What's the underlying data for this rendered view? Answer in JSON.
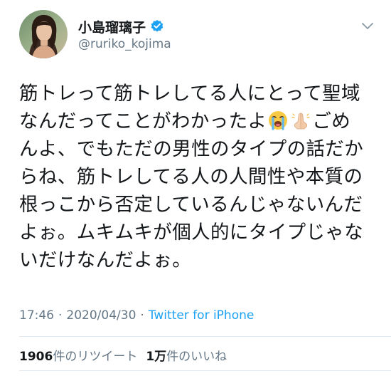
{
  "user": {
    "display_name": "小島瑠璃子",
    "handle": "@ruriko_kojima",
    "verified": true,
    "avatar_icon": "user-avatar-photo"
  },
  "tweet": {
    "lines": [
      "筋トレって筋トレしてる人にとって聖域",
      "なんだってことがわかったよ",
      "ごめ",
      "んよ、でもただの男性のタイプの話だか",
      "らね、筋トレしてる人の人間性や本質の",
      "根っこから否定しているんじゃないんだ",
      "よぉ。ムキムキが個人的にタイプじゃな",
      "いだけなんだよぉ。"
    ],
    "emojis": [
      "loudly-crying-face-emoji",
      "folded-hands-emoji"
    ]
  },
  "meta": {
    "time": "17:46",
    "separator": "·",
    "date": "2020/04/30",
    "source": "Twitter for iPhone"
  },
  "stats": {
    "retweets_count": "1906",
    "retweets_label": "件のリツイート",
    "likes_count": "1万",
    "likes_label": "件のいいね"
  },
  "colors": {
    "text_primary": "#14171a",
    "text_secondary": "#657786",
    "link": "#1da1f2",
    "verified": "#1da1f2",
    "divider": "#e1e8ed"
  }
}
